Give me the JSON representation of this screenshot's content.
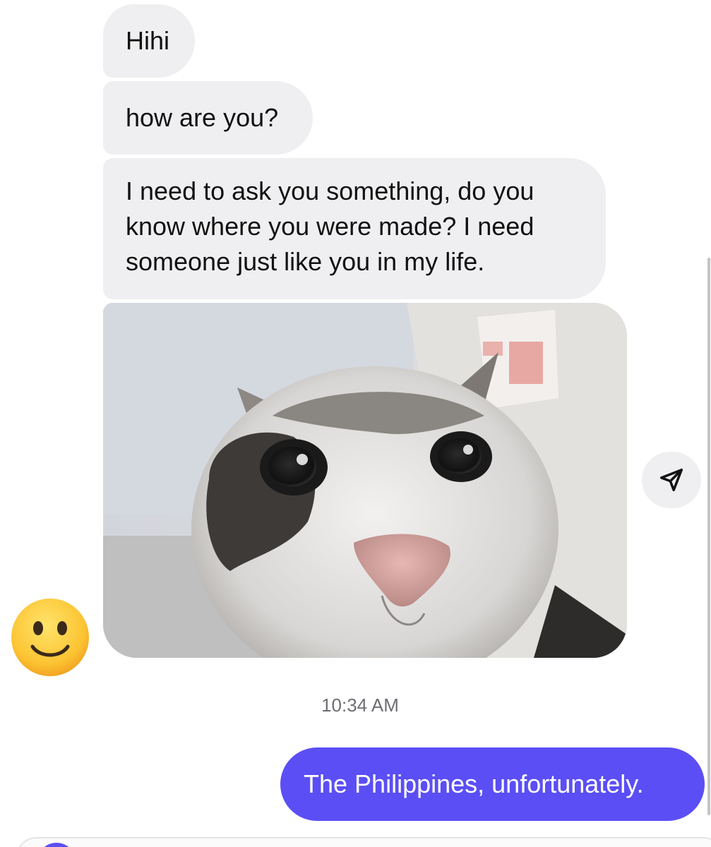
{
  "messages": {
    "received": [
      {
        "text": "Hihi"
      },
      {
        "text": "how are you?"
      },
      {
        "text": "I need to ask you something, do you know where you were made? I need someone just like you in my life."
      }
    ],
    "received_image_icon": "cat-closeup-photo",
    "timestamp": "10:34 AM",
    "sent": [
      {
        "text": "The Philippines, unfortunately."
      }
    ]
  },
  "icons": {
    "share": "paper-plane-icon",
    "avatar": "smiling-face-emoji"
  },
  "colors": {
    "received_bubble": "#efeff1",
    "sent_bubble": "#5b4ef5",
    "sent_text": "#ffffff",
    "timestamp": "#6e6e73"
  }
}
